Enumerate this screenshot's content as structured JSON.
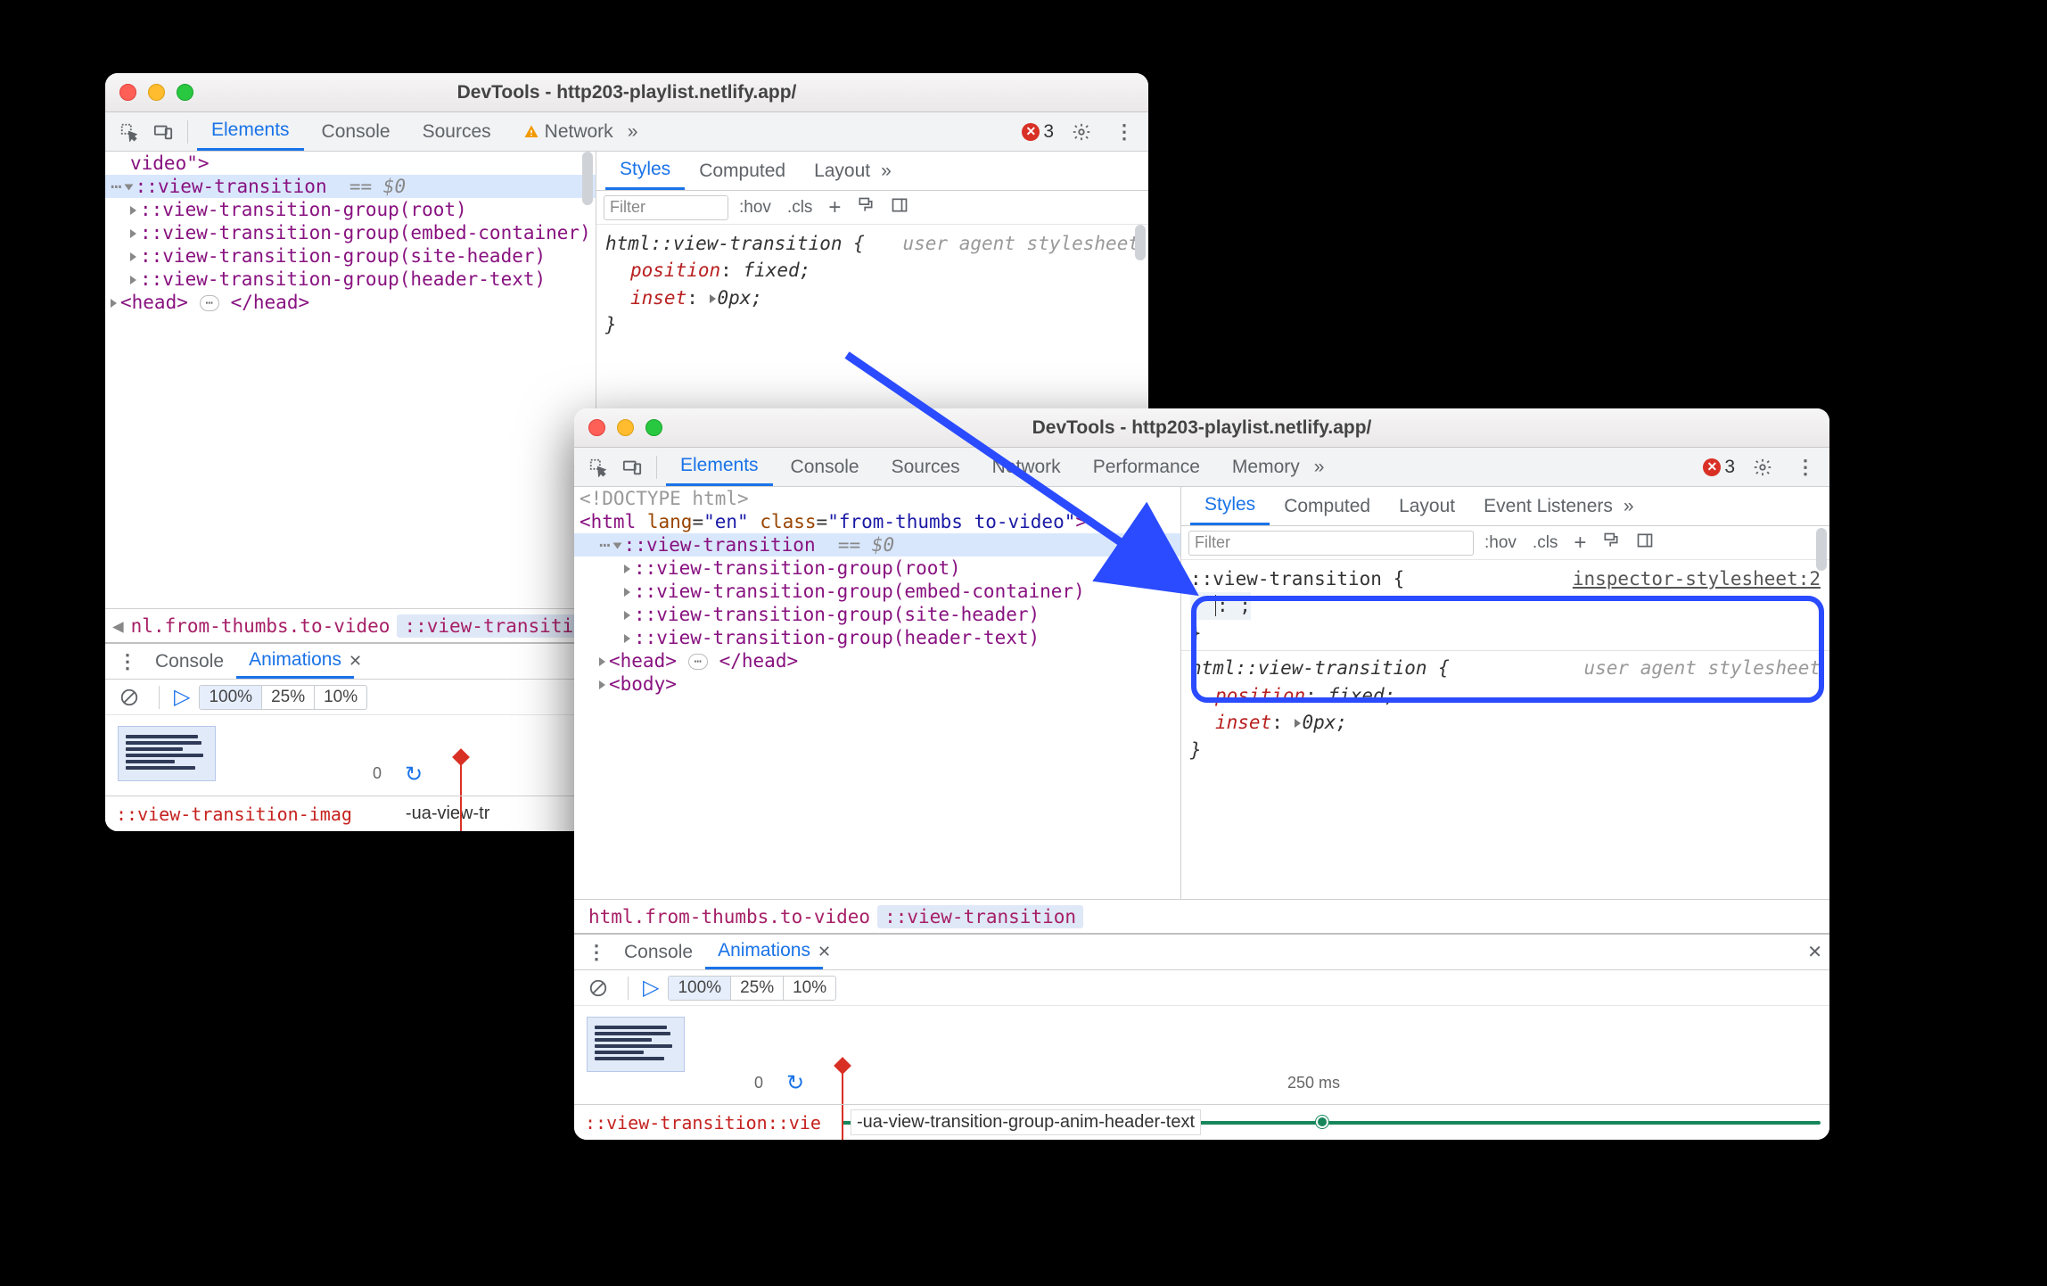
{
  "win1": {
    "title": "DevTools - http203-playlist.netlify.app/",
    "tabs": [
      "Elements",
      "Console",
      "Sources",
      "Network"
    ],
    "tab_selected": "Elements",
    "network_has_warning": true,
    "errors": "3",
    "dom": {
      "line0": "video\">",
      "selected": "::view-transition",
      "eq": "== $0",
      "children": [
        "::view-transition-group(root)",
        "::view-transition-group(embed-container)",
        "::view-transition-group(site-header)",
        "::view-transition-group(header-text)"
      ],
      "head_open": "<head>",
      "head_close": "</head>"
    },
    "crumbs": {
      "html": "nl.from-thumbs.to-video",
      "sel": "::view-transition"
    },
    "styles": {
      "tabs": [
        "Styles",
        "Computed",
        "Layout"
      ],
      "filter": "Filter",
      "hov": ":hov",
      "cls": ".cls",
      "rule_sel": "html::view-transition {",
      "ua": "user agent stylesheet",
      "p1_name": "position",
      "p1_val": "fixed;",
      "p2_name": "inset",
      "p2_val": "0px;",
      "close": "}"
    },
    "drawer": {
      "console": "Console",
      "anim": "Animations",
      "speeds": [
        "100%",
        "25%",
        "10%"
      ],
      "ms0": "0",
      "row_name": "::view-transition-imag",
      "row_anim": "-ua-view-tr"
    }
  },
  "win2": {
    "title": "DevTools - http203-playlist.netlify.app/",
    "tabs": [
      "Elements",
      "Console",
      "Sources",
      "Network",
      "Performance",
      "Memory"
    ],
    "tab_selected": "Elements",
    "errors": "3",
    "dom": {
      "doctype": "<!DOCTYPE html>",
      "html_open_a": "<html ",
      "lang_attr": "lang",
      "lang_val": "\"en\"",
      "class_attr": "class",
      "class_val": "\"from-thumbs to-video\"",
      "html_open_b": ">",
      "selected": "::view-transition",
      "eq": "== $0",
      "children": [
        "::view-transition-group(root)",
        "::view-transition-group(embed-container)",
        "::view-transition-group(site-header)",
        "::view-transition-group(header-text)"
      ],
      "head_open": "<head>",
      "head_close": "</head>",
      "body_open": "<body>"
    },
    "crumbs": {
      "html": "html.from-thumbs.to-video",
      "sel": "::view-transition"
    },
    "styles": {
      "tabs": [
        "Styles",
        "Computed",
        "Layout",
        "Event Listeners"
      ],
      "filter": "Filter",
      "hov": ":hov",
      "cls": ".cls",
      "new_sel": "::view-transition {",
      "new_src": "inspector-stylesheet:2",
      "new_body": ": ;",
      "close": "}",
      "rule_sel": "html::view-transition {",
      "ua": "user agent stylesheet",
      "p1_name": "position",
      "p1_val": "fixed;",
      "p2_name": "inset",
      "p2_val": "0px;"
    },
    "drawer": {
      "console": "Console",
      "anim": "Animations",
      "speeds": [
        "100%",
        "25%",
        "10%"
      ],
      "ms0": "0",
      "ms250": "250 ms",
      "row_name": "::view-transition::vie",
      "row_anim": "-ua-view-transition-group-anim-header-text"
    }
  }
}
